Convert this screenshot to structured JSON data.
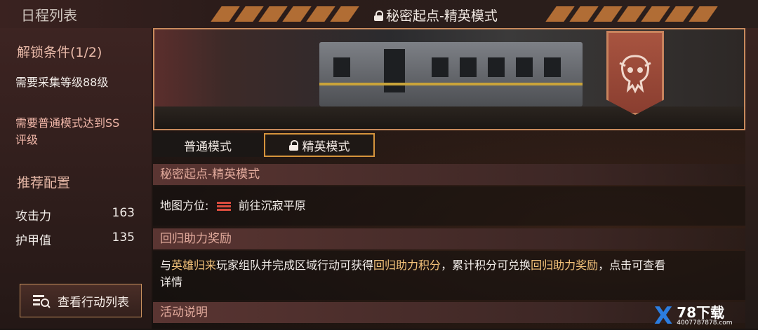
{
  "header": {
    "left_title": "日程列表",
    "center_title": "秘密起点-精英模式"
  },
  "left_panel": {
    "unlock_title": "解锁条件(1/2)",
    "unlock_cond_1": "需要采集等级88级",
    "unlock_cond_2_line1": "需要普通模式达到SS",
    "unlock_cond_2_line2": "评级",
    "recommend_title": "推荐配置",
    "stats": [
      {
        "label": "攻击力",
        "value": "163"
      },
      {
        "label": "护甲值",
        "value": "135"
      }
    ],
    "action_button": "查看行动列表"
  },
  "tabs": [
    {
      "label": "普通模式",
      "selected": false
    },
    {
      "label": "精英模式",
      "selected": true,
      "locked": true
    }
  ],
  "details": {
    "stage_title": "秘密起点-精英模式",
    "location_label": "地图方位:",
    "location_value": "前往沉寂平原",
    "reward_title": "回归助力奖励",
    "reward_desc": {
      "p1": "与",
      "p2": "英雄归来",
      "p3": "玩家组队并完成区域行动可获得",
      "p4": "回归助力积分",
      "p5": "，累计积分可兑换",
      "p6": "回归助力奖励",
      "p7": "，点击可查看",
      "p8": "详情"
    },
    "activity_title": "活动说明"
  },
  "watermark": {
    "mark": "X",
    "name": "78下载",
    "site": "4007787878.com"
  },
  "colors": {
    "accent_orange": "#d6943c",
    "highlight_text": "#e8a24a",
    "emblem_red": "#a85440"
  },
  "icons": [
    "lock-icon",
    "map-marker-icon",
    "action-list-icon",
    "skull-emblem-icon"
  ]
}
